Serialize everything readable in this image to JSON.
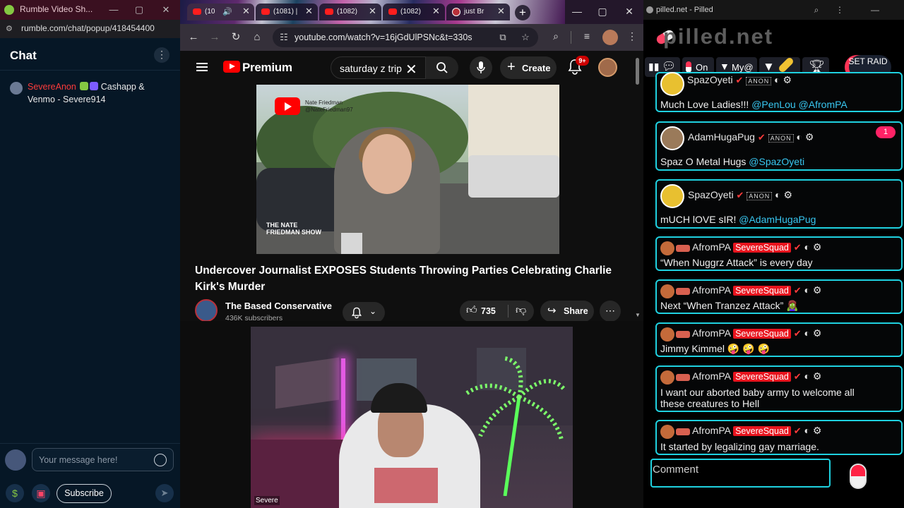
{
  "rumble": {
    "window_title": "Rumble Video Sh...",
    "url": "rumble.com/chat/popup/418454400",
    "chat_heading": "Chat",
    "message": {
      "username": "SevereAnon",
      "text": "Cashapp & Venmo - Severe914"
    },
    "input_placeholder": "Your message here!",
    "subscribe_label": "Subscribe"
  },
  "chrome": {
    "tabs": [
      {
        "title": "(10",
        "active": true
      },
      {
        "title": "(1081) |"
      },
      {
        "title": "(1082)"
      },
      {
        "title": "(1082)"
      },
      {
        "title": "just Br"
      }
    ],
    "url": "youtube.com/watch?v=16jGdUlPSNc&t=330s"
  },
  "youtube": {
    "brand": "Premium",
    "search_query": "saturday z trip",
    "create_label": "Create",
    "notifications": "9+",
    "video_title": "Undercover Journalist EXPOSES Students Throwing Parties Celebrating Charlie Kirk's Murder",
    "channel": "The Based Conservative",
    "subscribers": "436K subscribers",
    "likes": "735",
    "share_label": "Share",
    "watermark_name": "Nate Friedman",
    "watermark_handle": "@NateFriedman97",
    "watermark_show": "THE NATE FRIEDMAN SHOW"
  },
  "webcam": {
    "name_tag": "Severe"
  },
  "pilled": {
    "window_title": "pilled.net - Pilled",
    "logo": "pilled.net",
    "controls": {
      "on_label": "On",
      "my_label": "My@",
      "raid_label": "SET RAID"
    },
    "anon_badge": "ANON",
    "squad_badge": "SevereSquad",
    "unread_count": "1",
    "comment_placeholder": "Comment",
    "messages": [
      {
        "user": "SpazOyeti",
        "text": "Much Love Ladies!!! ",
        "mentions": "@PenLou @AfromPA"
      },
      {
        "user": "AdamHugaPug",
        "text": "Spaz O Metal Hugs ",
        "mentions": "@SpazOyeti"
      },
      {
        "user": "SpazOyeti",
        "text": "mUCH lOVE sIR! ",
        "mentions": "@AdamHugaPug"
      },
      {
        "user": "AfromPA",
        "text": "“When Nuggrz Attack” is every day"
      },
      {
        "user": "AfromPA",
        "text": "Next “When Tranzez Attack” 🧟‍♀️"
      },
      {
        "user": "AfromPA",
        "text": "Jimmy Kimmel 🤪 🤪 🤪"
      },
      {
        "user": "AfromPA",
        "text": "I want our aborted baby army to welcome all",
        "text2": "these creatures to Hell"
      },
      {
        "user": "AfromPA",
        "text": "It started by legalizing gay marriage."
      }
    ]
  }
}
